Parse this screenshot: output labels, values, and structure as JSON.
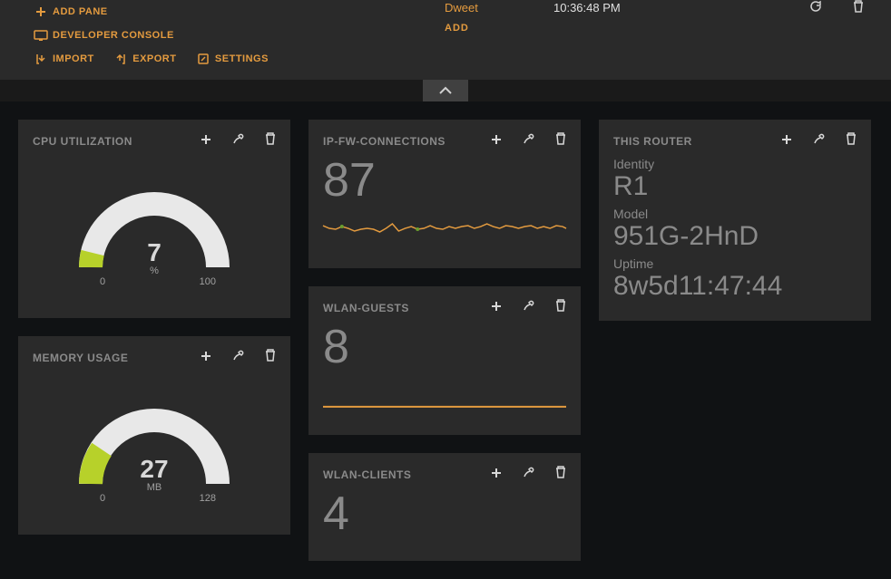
{
  "menu": {
    "add_pane": "ADD PANE",
    "developer_console": "DEVELOPER CONSOLE",
    "import": "IMPORT",
    "export": "EXPORT",
    "settings": "SETTINGS"
  },
  "datasource": {
    "name": "Dweet",
    "last_updated": "10:36:48 PM",
    "add": "ADD"
  },
  "panes": {
    "cpu": {
      "title": "CPU UTILIZATION",
      "value": "7",
      "unit": "%",
      "min": "0",
      "max": "100"
    },
    "memory": {
      "title": "MEMORY USAGE",
      "value": "27",
      "unit": "MB",
      "min": "0",
      "max": "128"
    },
    "ipfw": {
      "title": "IP-FW-CONNECTIONS",
      "value": "87"
    },
    "wlan_guests": {
      "title": "WLAN-GUESTS",
      "value": "8"
    },
    "wlan_clients": {
      "title": "WLAN-CLIENTS",
      "value": "4"
    },
    "router": {
      "title": "THIS ROUTER",
      "identity_label": "Identity",
      "identity_value": "R1",
      "model_label": "Model",
      "model_value": "951G-2HnD",
      "uptime_label": "Uptime",
      "uptime_value": "8w5d11:47:44"
    }
  },
  "chart_data": [
    {
      "type": "line",
      "title": "IP-FW-CONNECTIONS sparkline",
      "ylim": [
        70,
        100
      ],
      "values": [
        88,
        86,
        85,
        87,
        86,
        84,
        85,
        86,
        85,
        83,
        86,
        89,
        84,
        86,
        87,
        85,
        86,
        88,
        86,
        85,
        87,
        86,
        87,
        88,
        86,
        87,
        89,
        87,
        86,
        88,
        87,
        86,
        87,
        88,
        86,
        87,
        86,
        88,
        87,
        86
      ]
    },
    {
      "type": "line",
      "title": "WLAN-GUESTS sparkline",
      "ylim": [
        0,
        10
      ],
      "values": [
        8,
        8,
        8,
        8,
        8,
        8,
        8,
        8,
        8,
        8,
        8,
        8,
        8,
        8,
        8,
        8,
        8,
        8,
        8,
        8,
        8,
        8,
        8,
        8,
        8,
        8,
        8,
        8,
        8,
        8
      ]
    }
  ]
}
